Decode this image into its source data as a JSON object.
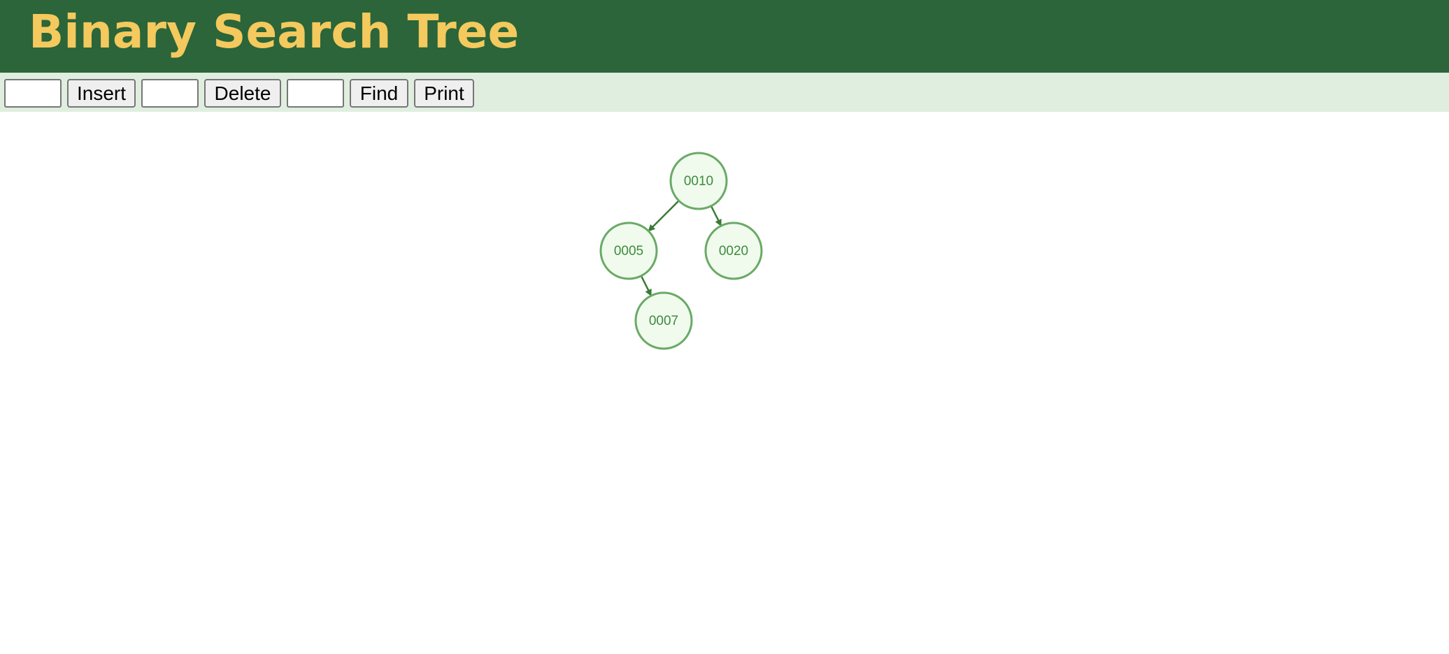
{
  "header": {
    "title": "Binary Search Tree"
  },
  "toolbar": {
    "insert_value": "",
    "insert_label": "Insert",
    "delete_value": "",
    "delete_label": "Delete",
    "find_value": "",
    "find_label": "Find",
    "print_label": "Print"
  },
  "tree": {
    "nodes": [
      {
        "id": "n10",
        "label": "0010"
      },
      {
        "id": "n5",
        "label": "0005"
      },
      {
        "id": "n20",
        "label": "0020"
      },
      {
        "id": "n7",
        "label": "0007"
      }
    ],
    "edges": [
      {
        "from": "n10",
        "to": "n5"
      },
      {
        "from": "n10",
        "to": "n20"
      },
      {
        "from": "n5",
        "to": "n7"
      }
    ]
  },
  "colors": {
    "header_bg": "#2b6539",
    "title_text": "#f4c95d",
    "toolbar_bg": "#e0eedf",
    "node_fill": "#f0fbee",
    "node_stroke": "#6aaa66",
    "node_text": "#3f8a3c",
    "edge": "#3a7a36"
  }
}
